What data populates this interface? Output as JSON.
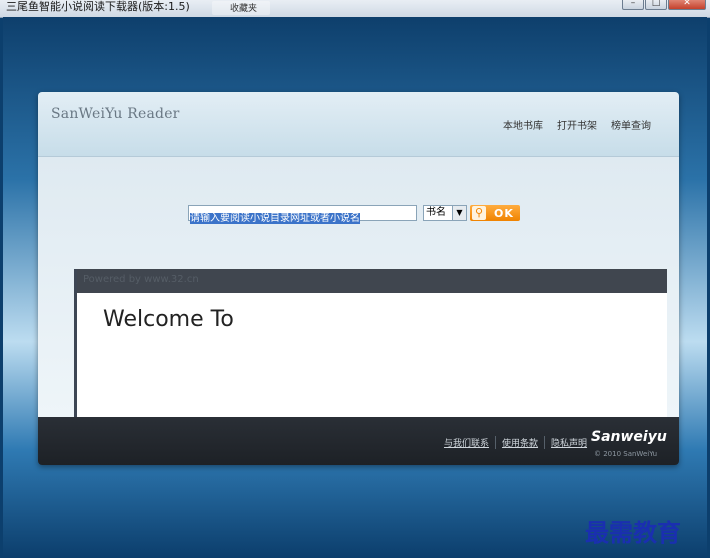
{
  "window": {
    "title": "三尾鱼智能小说阅读下载器(版本:1.5)",
    "taskbar_ghost": "收藏夹"
  },
  "app": {
    "brand": "SanWeiYu Reader",
    "nav": [
      "本地书库",
      "打开书架",
      "榜单查询"
    ]
  },
  "search": {
    "value": "请输入要阅读小说目录网址或者小说名",
    "select_value": "书名",
    "ok_label": "OK"
  },
  "content": {
    "powered": "Powered by www.32.cn",
    "welcome": "Welcome To"
  },
  "footer": {
    "links": [
      "与我们联系",
      "使用条款",
      "隐私声明"
    ],
    "logo": "Sanweiyu",
    "copyright": "© 2010 SanWeiYu"
  },
  "watermark": "最需教育",
  "colors": {
    "accent_orange": "#f08300",
    "frame_blue": "#0c3f6d",
    "footer_dark": "#1d2126"
  }
}
